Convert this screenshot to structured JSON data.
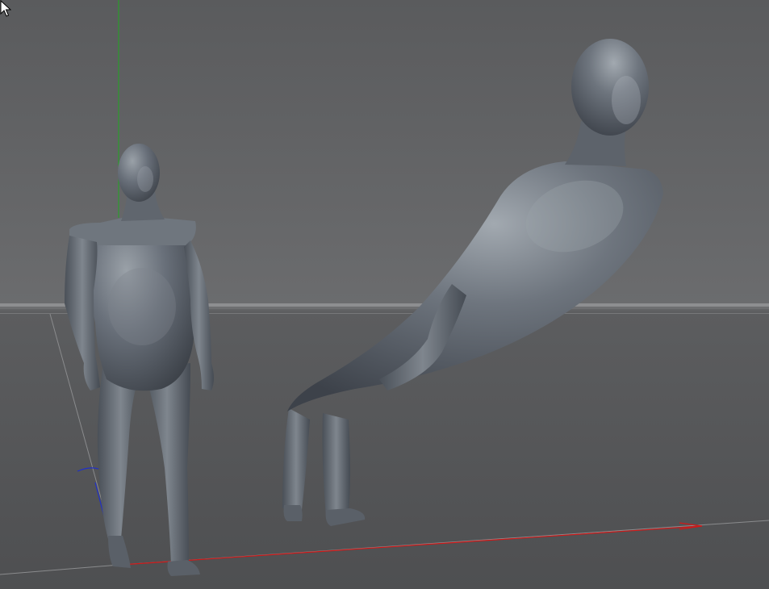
{
  "viewport": {
    "background": "#4f5051",
    "horizon_color": "#7f8082",
    "grid_color": "#8a8b8d",
    "axes": {
      "x_color": "#d01818",
      "y_color": "#1fa81f",
      "z_color": "#2030c8"
    }
  },
  "scene": {
    "objects": [
      {
        "name": "standing-figure",
        "type": "mesh",
        "material_color": "#5f656c"
      },
      {
        "name": "deformed-figure",
        "type": "mesh",
        "material_color": "#5f656c"
      }
    ]
  },
  "cursor": {
    "icon": "arrow-cursor-icon"
  }
}
